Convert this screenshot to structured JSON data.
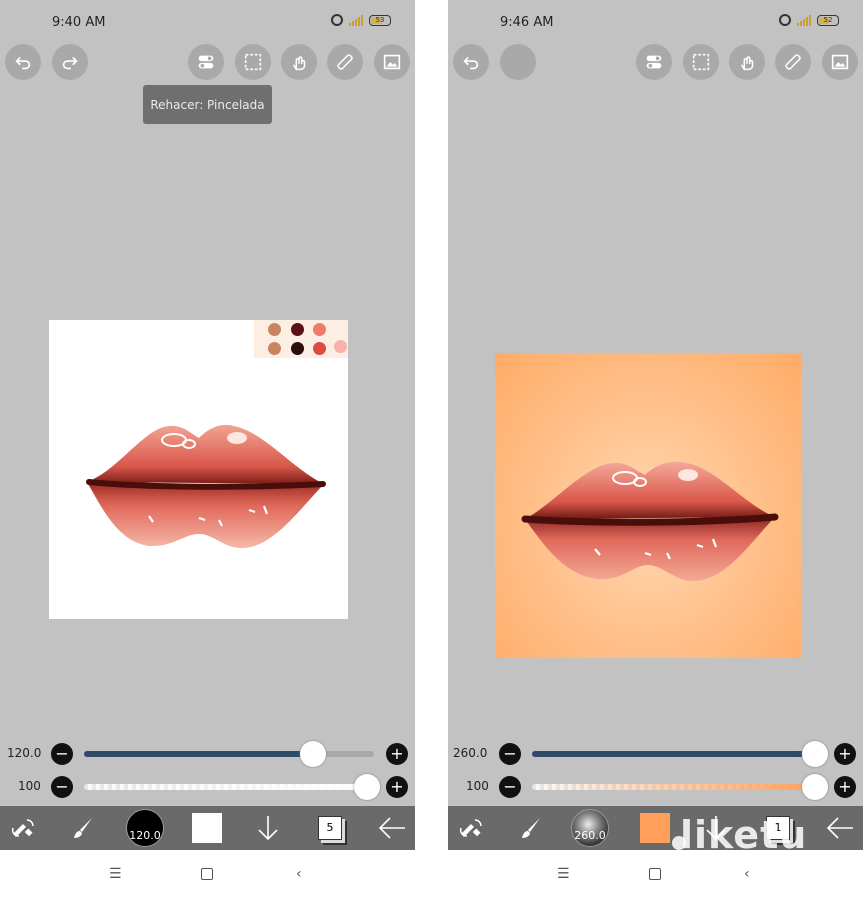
{
  "left_screen": {
    "status": {
      "time": "9:40 AM",
      "battery": "53"
    },
    "tooltip": "Rehacer: Pincelada",
    "size_slider": {
      "value_label": "120.0",
      "fraction": 0.79
    },
    "opacity_slider": {
      "value_label": "100",
      "fraction": 1.0
    },
    "bottom_bar": {
      "brush_size_label": "120.0",
      "color": "#ffffff",
      "layer_number": "5"
    },
    "palette_colors": [
      "#c98563",
      "#5a1212",
      "#ee7a6e",
      "#c98563",
      "#2a0d0d",
      "#dc4a42",
      "#f6b2a8"
    ]
  },
  "right_screen": {
    "status": {
      "time": "9:46 AM",
      "battery": "52"
    },
    "size_slider": {
      "value_label": "260.0",
      "fraction": 1.0
    },
    "opacity_slider": {
      "value_label": "100",
      "fraction": 1.0
    },
    "bottom_bar": {
      "brush_size_label": "260.0",
      "color": "#ff9f5a",
      "layer_number": "1"
    }
  },
  "watermark": "liketu",
  "colors": {
    "slider_fill": "#2f4b6b",
    "app_bg": "#c2c2c2",
    "bottom_bar": "#6a6a6a"
  }
}
